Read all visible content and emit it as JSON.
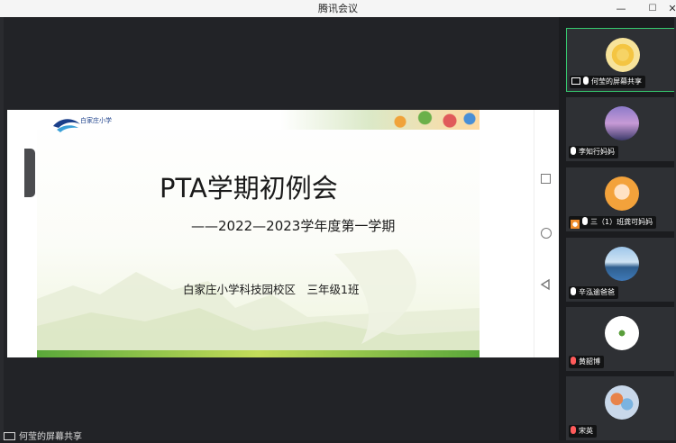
{
  "window": {
    "title": "腾讯会议",
    "min_label": "—",
    "max_label": "☐",
    "close_label": "✕"
  },
  "slide": {
    "logo_text": "白家庄小学",
    "title": "PTA学期初例会",
    "subtitle": "——2022—2023学年度第一学期",
    "school": "白家庄小学科技园校区　三年级1班"
  },
  "share_label": "何莹的屏幕共享",
  "participants": [
    {
      "name": "何莹的屏幕共享",
      "icon": "screen-share-icon",
      "mic": "on",
      "active": true,
      "avatar": "sunflower",
      "color": "#f4c542"
    },
    {
      "name": "李知行妈妈",
      "icon": "mic-icon",
      "mic": "on",
      "active": false,
      "avatar": "sky-tree",
      "color": "#b77ac9"
    },
    {
      "name": "三（1）班龚可妈妈",
      "icon": "user-icon",
      "mic": "on",
      "active": false,
      "avatar": "child",
      "color": "#f3a23b"
    },
    {
      "name": "辛泓逾爸爸",
      "icon": "mic-icon",
      "mic": "on",
      "active": false,
      "avatar": "lake",
      "color": "#3f79b8"
    },
    {
      "name": "黄韶博",
      "icon": "mic-icon",
      "mic": "muted",
      "active": false,
      "avatar": "cartoon",
      "color": "#ffffff"
    },
    {
      "name": "宋英",
      "icon": "mic-icon",
      "mic": "muted",
      "active": false,
      "avatar": "balloons",
      "color": "#e8834a"
    }
  ]
}
